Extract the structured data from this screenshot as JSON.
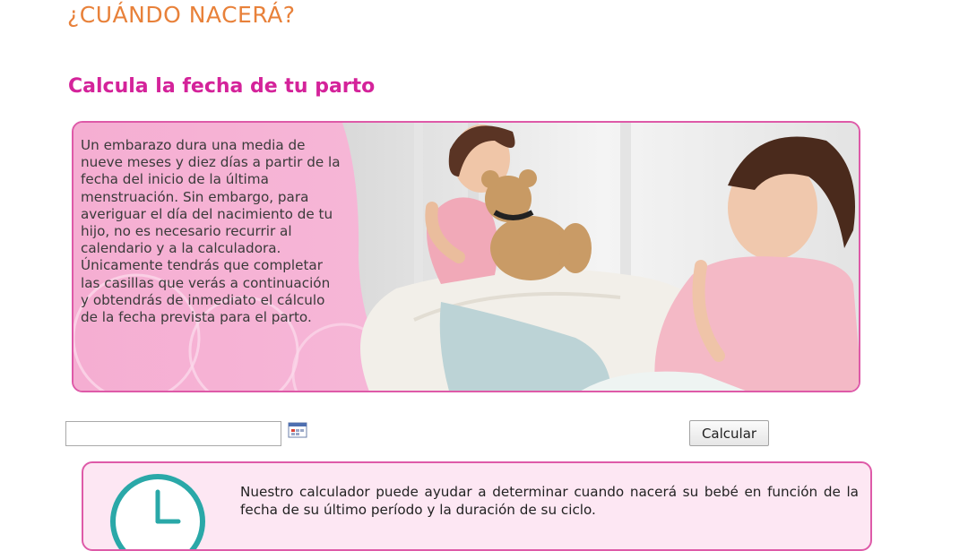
{
  "header": {
    "title": "¿CUÁNDO NACERÁ?"
  },
  "section": {
    "title": "Calcula la fecha de tu parto"
  },
  "banner": {
    "intro": "Un embarazo dura una media de nueve meses y diez días a partir de la fecha del inicio de la última menstruación. Sin embargo, para averiguar el día del nacimiento de tu hijo, no es necesario recurrir al calendario y a la calculadora. Únicamente tendrás que completar las casillas que verás a continuación y obtendrás de inmediato el cálculo de la fecha prevista para el parto."
  },
  "form": {
    "date_value": "",
    "calendar_icon": "calendar-icon",
    "calculate_label": "Calcular"
  },
  "info": {
    "icon": "clock-icon",
    "text": "Nuestro calculador puede ayudar a determinar cuando nacerá su bebé en función de la fecha de su último período y la duración de su ciclo."
  },
  "colors": {
    "title_orange": "#e8813a",
    "heading_pink": "#d4239a",
    "border_pink": "#de5aa8",
    "banner_pink": "#f7bddb",
    "info_bg": "#fde7f3",
    "clock_teal": "#2aa8a8"
  }
}
